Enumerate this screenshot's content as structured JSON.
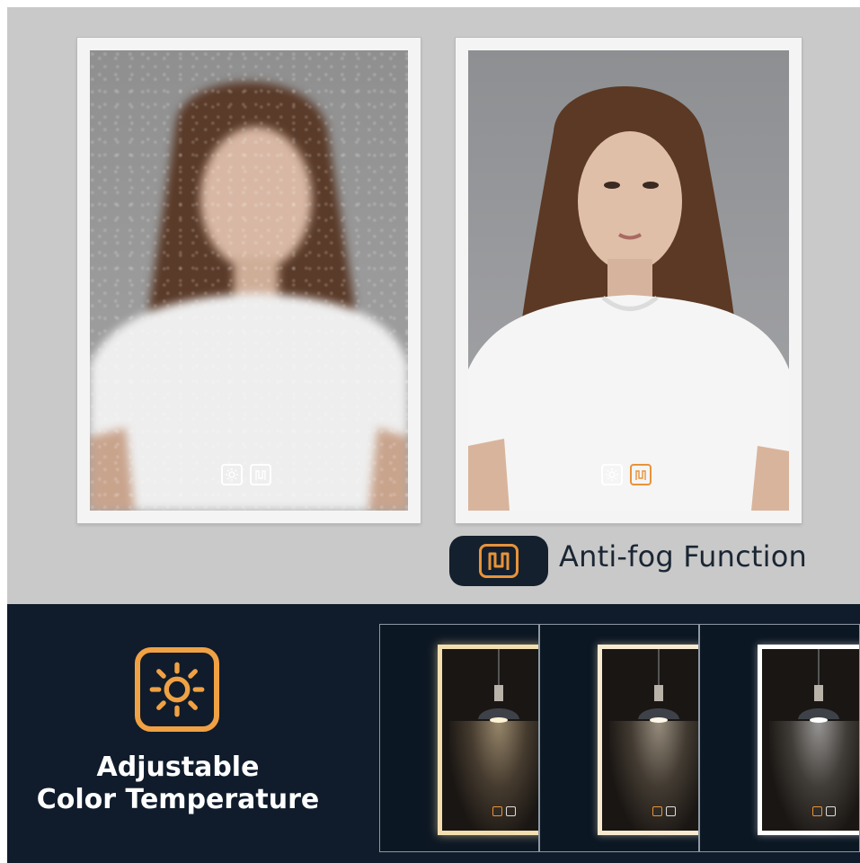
{
  "anti_fog": {
    "label": "Anti-fog Function"
  },
  "color_temp": {
    "line1": "Adjustable",
    "line2": "Color Temperature"
  },
  "colors": {
    "accent": "#e8933a",
    "navy": "#101c2b",
    "top_bg": "#c9c9c9"
  },
  "icons": [
    "sun-brightness-icon",
    "defog-heater-icon",
    "pendant-lamp-icon"
  ]
}
